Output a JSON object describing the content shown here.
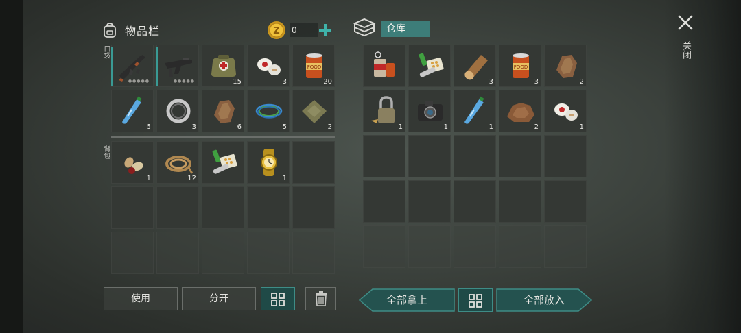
{
  "inventory": {
    "title": "物品栏",
    "coins": "0",
    "pocket_label": "口袋",
    "backpack_label": "背包",
    "pocket_slots": [
      {
        "icon": "ak-rifle-icon",
        "count": "",
        "weapon": true
      },
      {
        "icon": "smg-icon",
        "count": "",
        "weapon": true
      },
      {
        "icon": "medkit-bag-icon",
        "count": "15"
      },
      {
        "icon": "bandage-roll-icon",
        "count": "3"
      },
      {
        "icon": "canned-food-icon",
        "count": "20"
      },
      {
        "icon": "water-bottle-icon",
        "count": "5"
      },
      {
        "icon": "bearing-ring-icon",
        "count": "3"
      },
      {
        "icon": "fur-pelt-icon",
        "count": "6"
      },
      {
        "icon": "wire-coil-icon",
        "count": "5"
      },
      {
        "icon": "cloth-icon",
        "count": "2"
      }
    ],
    "backpack_slots": [
      {
        "icon": "seeds-icon",
        "count": "1"
      },
      {
        "icon": "rope-icon",
        "count": "12"
      },
      {
        "icon": "medicine-kit-icon",
        "count": ""
      },
      {
        "icon": "gold-watch-icon",
        "count": "1"
      }
    ]
  },
  "warehouse": {
    "title": "仓库",
    "slots": [
      {
        "icon": "food-ration-icon",
        "count": ""
      },
      {
        "icon": "medicine-kit-icon",
        "count": ""
      },
      {
        "icon": "wood-log-icon",
        "count": "3"
      },
      {
        "icon": "canned-food-icon",
        "count": "3"
      },
      {
        "icon": "fur-pelt-icon",
        "count": "2"
      },
      {
        "icon": "padlock-icon",
        "count": "1"
      },
      {
        "icon": "camera-icon",
        "count": "1"
      },
      {
        "icon": "water-bottle-icon",
        "count": "1"
      },
      {
        "icon": "leather-hide-icon",
        "count": "2"
      },
      {
        "icon": "bandage-roll-icon",
        "count": "1"
      }
    ]
  },
  "close_label": "关闭",
  "buttons": {
    "use": "使用",
    "split": "分开",
    "take_all": "全部拿上",
    "put_all": "全部放入"
  },
  "colors": {
    "accent": "#3d7d79",
    "slot": "#343834"
  }
}
